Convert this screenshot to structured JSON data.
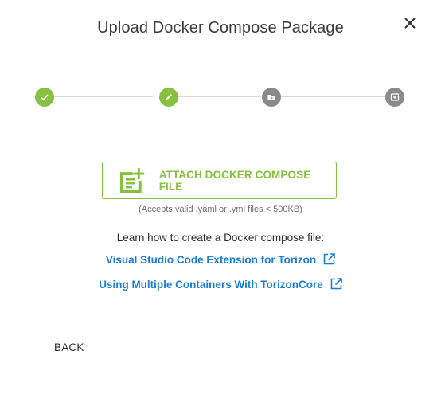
{
  "dialog": {
    "title": "Upload Docker Compose Package",
    "close_icon": "close-icon"
  },
  "stepper": {
    "steps": [
      {
        "state": "completed",
        "icon": "check-icon"
      },
      {
        "state": "active",
        "icon": "pencil-icon"
      },
      {
        "state": "pending",
        "icon": "folder-icon"
      },
      {
        "state": "pending",
        "icon": "add-box-icon"
      }
    ],
    "colors": {
      "completed": "#86c13f",
      "pending": "#8a8a8a"
    }
  },
  "attach": {
    "label": "ATTACH DOCKER COMPOSE FILE",
    "icon": "note-add-icon",
    "hint": "(Accepts valid .yaml or .yml files < 500KB)"
  },
  "learn": {
    "heading": "Learn how to create a Docker compose file:",
    "links": [
      {
        "label": "Visual Studio Code Extension for Torizon",
        "icon": "external-link-icon"
      },
      {
        "label": "Using Multiple Containers With TorizonCore",
        "icon": "external-link-icon"
      }
    ]
  },
  "footer": {
    "back_label": "BACK"
  },
  "colors": {
    "accent": "#86c13f",
    "link": "#1a7ed4"
  }
}
